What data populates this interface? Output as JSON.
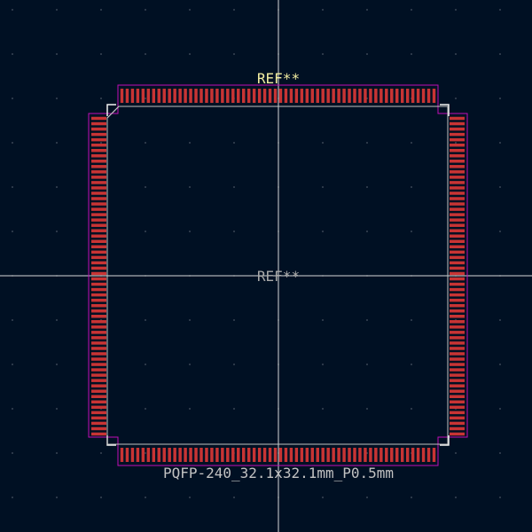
{
  "footprint": {
    "reference_top": "REF**",
    "reference_center": "REF**",
    "value": "PQFP-240_32.1x32.1mm_P0.5mm",
    "pins_per_side": 60
  },
  "colors": {
    "background": "#001023",
    "grid_dot": "#4a5563",
    "crosshair": "#d8d8d8",
    "pad": "#c83434",
    "courtyard": "#c20eb7",
    "silkscreen": "#f2f2f2",
    "fab_outline": "#c2c2c2"
  }
}
